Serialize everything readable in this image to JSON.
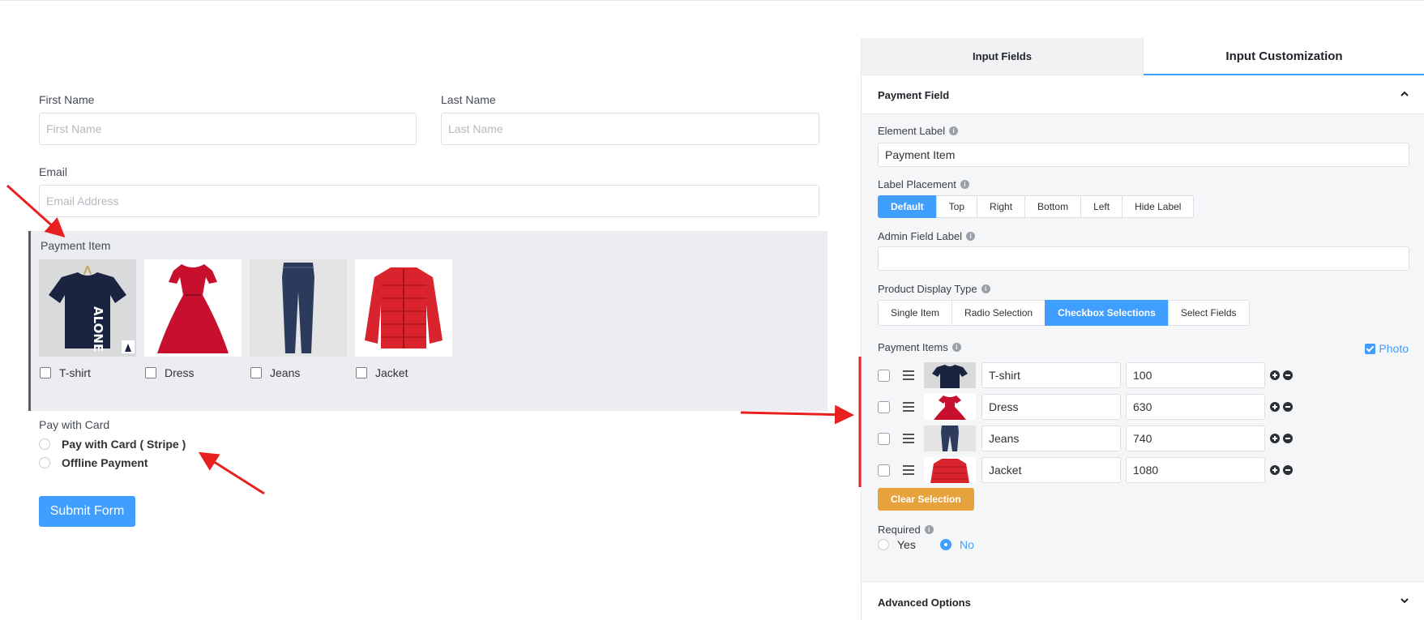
{
  "form": {
    "first_name": {
      "label": "First Name",
      "placeholder": "First Name"
    },
    "last_name": {
      "label": "Last Name",
      "placeholder": "Last Name"
    },
    "email": {
      "label": "Email",
      "placeholder": "Email Address"
    },
    "payment_item": {
      "label": "Payment Item",
      "products": [
        {
          "name": "T-shirt",
          "image": "tshirt-image",
          "shirt_text": "ALONE"
        },
        {
          "name": "Dress",
          "image": "dress-image"
        },
        {
          "name": "Jeans",
          "image": "jeans-image"
        },
        {
          "name": "Jacket",
          "image": "jacket-image"
        }
      ]
    },
    "pay_with_card": {
      "label": "Pay with Card",
      "options": [
        "Pay with Card ( Stripe )",
        "Offline Payment"
      ]
    },
    "submit_label": "Submit Form"
  },
  "panel": {
    "tabs": [
      "Input Fields",
      "Input Customization"
    ],
    "active_tab": "Input Customization",
    "section_title": "Payment Field",
    "element_label": {
      "label": "Element Label",
      "value": "Payment Item"
    },
    "label_placement": {
      "label": "Label Placement",
      "options": [
        "Default",
        "Top",
        "Right",
        "Bottom",
        "Left",
        "Hide Label"
      ],
      "selected": "Default"
    },
    "admin_field_label": {
      "label": "Admin Field Label",
      "value": ""
    },
    "product_display_type": {
      "label": "Product Display Type",
      "options": [
        "Single Item",
        "Radio Selection",
        "Checkbox Selections",
        "Select Fields"
      ],
      "selected": "Checkbox Selections"
    },
    "payment_items": {
      "label": "Payment Items",
      "photo_label": "Photo",
      "photo_checked": true,
      "rows": [
        {
          "name": "T-shirt",
          "price": "100"
        },
        {
          "name": "Dress",
          "price": "630"
        },
        {
          "name": "Jeans",
          "price": "740"
        },
        {
          "name": "Jacket",
          "price": "1080"
        }
      ]
    },
    "clear_selection_label": "Clear Selection",
    "required": {
      "label": "Required",
      "options": [
        "Yes",
        "No"
      ],
      "selected": "No"
    },
    "advanced_options_label": "Advanced Options"
  },
  "colors": {
    "accent": "#409eff",
    "warning": "#e6a23c",
    "annotation_arrow": "#e8201f"
  },
  "icons": [
    "info-icon",
    "chevron-up-icon",
    "chevron-down-icon",
    "drag-handle-icon",
    "plus-circle-icon",
    "minus-circle-icon",
    "checkbox-icon"
  ]
}
